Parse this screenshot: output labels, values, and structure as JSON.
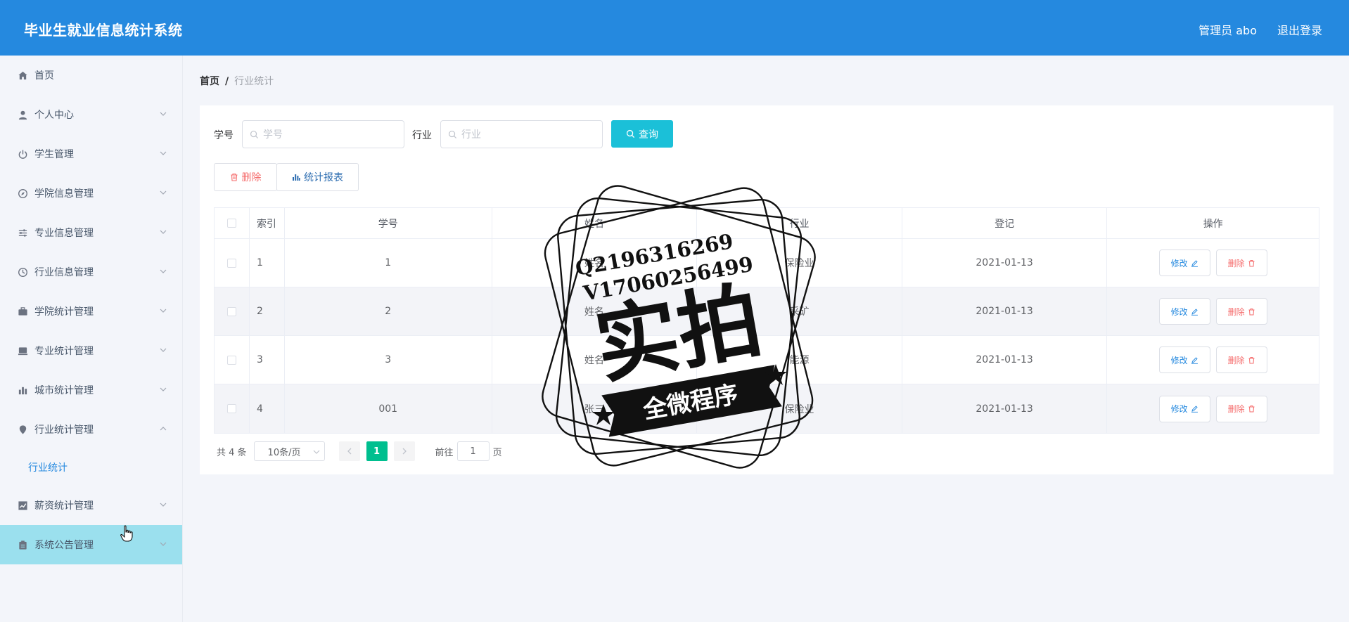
{
  "header": {
    "title": "毕业生就业信息统计系统",
    "user": "管理员 abo",
    "logout": "退出登录"
  },
  "sidebar": {
    "items": [
      {
        "label": "首页",
        "icon": "home-icon"
      },
      {
        "label": "个人中心",
        "icon": "user-icon"
      },
      {
        "label": "学生管理",
        "icon": "power-icon"
      },
      {
        "label": "学院信息管理",
        "icon": "compass-icon"
      },
      {
        "label": "专业信息管理",
        "icon": "sliders-icon"
      },
      {
        "label": "行业信息管理",
        "icon": "clock-icon"
      },
      {
        "label": "学院统计管理",
        "icon": "briefcase-icon"
      },
      {
        "label": "专业统计管理",
        "icon": "monitor-icon"
      },
      {
        "label": "城市统计管理",
        "icon": "bar-chart-icon"
      },
      {
        "label": "行业统计管理",
        "icon": "location-icon"
      },
      {
        "label": "行业统计",
        "icon": ""
      },
      {
        "label": "薪资统计管理",
        "icon": "line-chart-icon"
      },
      {
        "label": "系统公告管理",
        "icon": "notice-icon"
      }
    ]
  },
  "breadcrumb": {
    "home": "首页",
    "separator": "/",
    "current": "行业统计"
  },
  "search": {
    "student_no_label": "学号",
    "student_no_placeholder": "学号",
    "industry_label": "行业",
    "industry_placeholder": "行业",
    "query_button": "查询"
  },
  "actions": {
    "delete": "删除",
    "report": "统计报表"
  },
  "table": {
    "headers": {
      "index": "索引",
      "student_no": "学号",
      "name": "姓名",
      "industry": "行业",
      "date": "登记",
      "ops": "操作"
    },
    "rows": [
      {
        "index": "1",
        "student_no": "1",
        "name": "姓名",
        "industry": "保险业",
        "date": "2021-01-13"
      },
      {
        "index": "2",
        "student_no": "2",
        "name": "姓名",
        "industry": "采矿",
        "date": "2021-01-13"
      },
      {
        "index": "3",
        "student_no": "3",
        "name": "姓名",
        "industry": "能源",
        "date": "2021-01-13"
      },
      {
        "index": "4",
        "student_no": "001",
        "name": "张三",
        "industry": "保险业",
        "date": "2021-01-13"
      }
    ],
    "edit_label": "修改",
    "delete_label": "删除"
  },
  "pagination": {
    "total": "共 4 条",
    "page_size": "10条/页",
    "current_page": "1",
    "goto_prefix": "前往",
    "goto_value": "1",
    "goto_suffix": "页"
  },
  "watermark": {
    "line1": "Q2196316269",
    "line2": "V17060256499",
    "main": "实拍",
    "banner": "全微程序"
  },
  "colors": {
    "header": "#2589df",
    "active_menu": "#9be0ee",
    "query_button": "#1bc0d8",
    "current_page": "#00bf8f"
  }
}
